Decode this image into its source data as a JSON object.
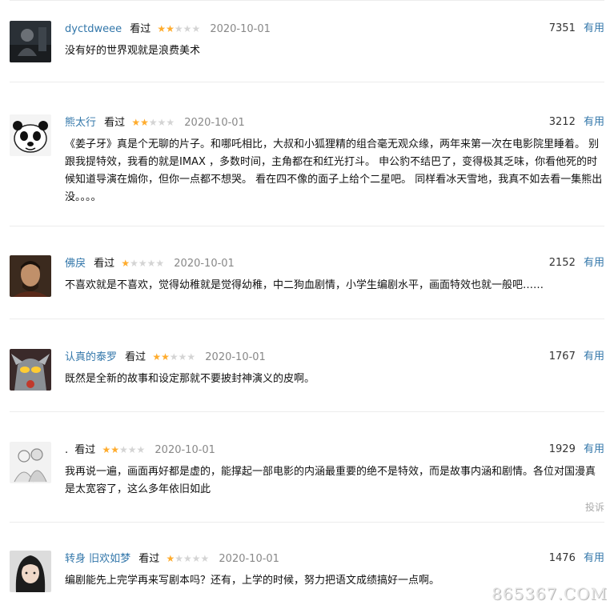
{
  "comments": [
    {
      "username": "dyctdweee",
      "status": "看过",
      "rating": 2,
      "date": "2020-10-01",
      "votes": "7351",
      "useful_label": "有用",
      "content": "没有好的世界观就是浪费美术",
      "avatar_icon": "dark-figure-avatar"
    },
    {
      "username": "熊太行",
      "status": "看过",
      "rating": 2,
      "date": "2020-10-01",
      "votes": "3212",
      "useful_label": "有用",
      "content": "《姜子牙》真是个无聊的片子。和哪吒相比，大叔和小狐狸精的组合毫无观众缘，两年来第一次在电影院里睡着。 别跟我提特效，我看的就是IMAX ，多数时间，主角都在和红光打斗。 申公豹不结巴了，变得极其乏味，你看他死的时候知道导演在煽你，但你一点都不想哭。 看在四不像的面子上给个二星吧。 同样看冰天雪地，我真不如去看一集熊出没。。。。",
      "avatar_icon": "panda-avatar"
    },
    {
      "username": "佛戾",
      "status": "看过",
      "rating": 1,
      "date": "2020-10-01",
      "votes": "2152",
      "useful_label": "有用",
      "content": "不喜欢就是不喜欢，觉得幼稚就是觉得幼稚，中二狗血剧情，小学生编剧水平，画面特效也就一般吧……",
      "avatar_icon": "man-portrait-avatar"
    },
    {
      "username": "认真的泰罗",
      "status": "看过",
      "rating": 2,
      "date": "2020-10-01",
      "votes": "1767",
      "useful_label": "有用",
      "content": "既然是全新的故事和设定那就不要披封神演义的皮啊。",
      "avatar_icon": "ultraman-avatar"
    },
    {
      "username": ".",
      "status": "看过",
      "rating": 2,
      "date": "2020-10-01",
      "votes": "1929",
      "useful_label": "有用",
      "content": "我再说一遍，画面再好都是虚的，能撑起一部电影的内涵最重要的绝不是特效，而是故事内涵和剧情。各位对国漫真是太宽容了，这么多年依旧如此",
      "report_label": "投诉",
      "avatar_icon": "sketch-couple-avatar"
    },
    {
      "username": "转身 旧欢如梦",
      "status": "看过",
      "rating": 1,
      "date": "2020-10-01",
      "votes": "1476",
      "useful_label": "有用",
      "content": "编剧能先上完学再来写剧本吗？还有，上学的时候，努力把语文成绩搞好一点啊。",
      "avatar_icon": "girl-portrait-avatar"
    }
  ],
  "watermark": "865367.COM",
  "colors": {
    "link": "#3377aa",
    "star_on": "#ffac2d",
    "star_off": "#d4d4d4",
    "date": "#888888",
    "separator": "#ececec"
  }
}
